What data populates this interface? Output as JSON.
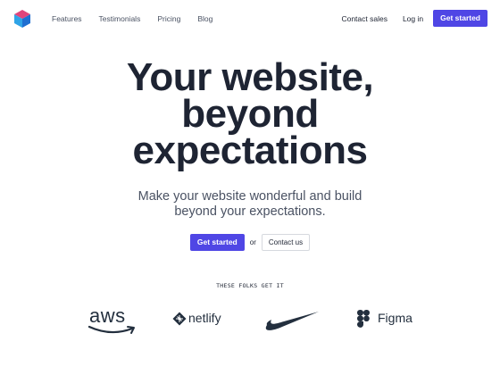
{
  "nav": {
    "links": [
      "Features",
      "Testimonials",
      "Pricing",
      "Blog"
    ],
    "contact_sales": "Contact sales",
    "login": "Log in",
    "cta": "Get started"
  },
  "hero": {
    "title_line1": "Your website,",
    "title_line2": "beyond",
    "title_line3": "expectations",
    "subtitle_line1": "Make your website wonderful and build",
    "subtitle_line2": "beyond your expectations.",
    "primary_cta": "Get started",
    "or_text": "or",
    "secondary_cta": "Contact us"
  },
  "social_proof": {
    "heading": "THESE FOLKS GET IT",
    "logos": [
      {
        "name": "aws",
        "text": "aws"
      },
      {
        "name": "netlify",
        "text": "netlify"
      },
      {
        "name": "nike",
        "text": ""
      },
      {
        "name": "figma",
        "text": "Figma"
      }
    ]
  },
  "colors": {
    "accent": "#4f46e5",
    "text_dark": "#1e2433",
    "text_muted": "#4a5263"
  },
  "icons": {
    "brand_logo": "cube-icon"
  }
}
